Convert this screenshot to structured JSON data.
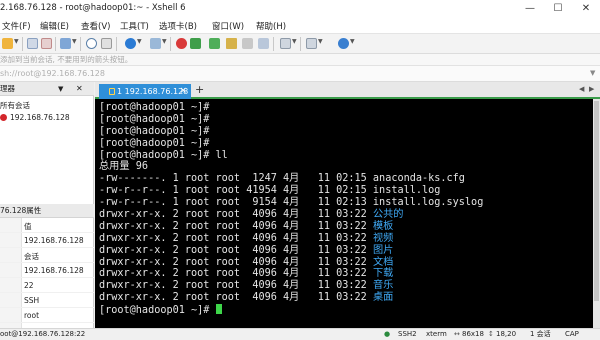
{
  "window": {
    "title": "2.168.76.128 - root@hadoop01:~ - Xshell 6",
    "minimize_icon": "minimize-icon",
    "maximize_icon": "maximize-icon",
    "close_icon": "close-icon"
  },
  "menu": {
    "items": [
      {
        "label": "文件(F)"
      },
      {
        "label": "编辑(E)"
      },
      {
        "label": "查看(V)"
      },
      {
        "label": "工具(T)"
      },
      {
        "label": "选项卡(B)"
      },
      {
        "label": "窗口(W)"
      },
      {
        "label": "帮助(H)"
      }
    ]
  },
  "hint_text": "添加到当前会话,              不要用到的箭头按钮。",
  "address": {
    "value": "sh://root@192.168.76.128",
    "dropdown_icon": "chevron-down-icon"
  },
  "session_panel": {
    "title": "理器",
    "pin_icon": "pin-icon",
    "close_icon": "close-icon",
    "root_label": "所有会话",
    "session_label": "192.168.76.128",
    "session_icon": "session-icon"
  },
  "properties_panel": {
    "title": "76.128属性",
    "header_value": "值",
    "values": [
      "192.168.76.128",
      "会话",
      "192.168.76.128",
      "22",
      "SSH",
      "root"
    ]
  },
  "tab": {
    "label": "1 192.168.76.128",
    "add_label": "+",
    "lock_icon": "lock-icon",
    "close_label": "×"
  },
  "terminal": {
    "lines": [
      {
        "text": "[root@hadoop01 ~]#"
      },
      {
        "text": "[root@hadoop01 ~]#"
      },
      {
        "text": "[root@hadoop01 ~]#"
      },
      {
        "text": "[root@hadoop01 ~]#"
      },
      {
        "text": "[root@hadoop01 ~]# ll"
      },
      {
        "text": "总用量 96"
      },
      {
        "text": "-rw-------. 1 root root  1247 4月   11 02:15 anaconda-ks.cfg"
      },
      {
        "text": "-rw-r--r--. 1 root root 41954 4月   11 02:15 install.log"
      },
      {
        "text": "-rw-r--r--. 1 root root  9154 4月   11 02:13 install.log.syslog"
      },
      {
        "prefix": "drwxr-xr-x. 2 root root  4096 4月   11 03:22 ",
        "dir": "公共的"
      },
      {
        "prefix": "drwxr-xr-x. 2 root root  4096 4月   11 03:22 ",
        "dir": "模板"
      },
      {
        "prefix": "drwxr-xr-x. 2 root root  4096 4月   11 03:22 ",
        "dir": "视频"
      },
      {
        "prefix": "drwxr-xr-x. 2 root root  4096 4月   11 03:22 ",
        "dir": "图片"
      },
      {
        "prefix": "drwxr-xr-x. 2 root root  4096 4月   11 03:22 ",
        "dir": "文档"
      },
      {
        "prefix": "drwxr-xr-x. 2 root root  4096 4月   11 03:22 ",
        "dir": "下载"
      },
      {
        "prefix": "drwxr-xr-x. 2 root root  4096 4月   11 03:22 ",
        "dir": "音乐"
      },
      {
        "prefix": "drwxr-xr-x. 2 root root  4096 4月   11 03:22 ",
        "dir": "桌面"
      }
    ],
    "prompt": "[root@hadoop01 ~]# ",
    "colors": {
      "background": "#000000",
      "text": "#e4e4e4",
      "directory": "#3fa9f5",
      "cursor": "#3ed64a"
    }
  },
  "status": {
    "connection": "oot@192.168.76.128:22",
    "protocol": "SSH2",
    "terminal_type": "xterm",
    "size": "86x18",
    "position": "18,20",
    "sessions": "1 会话",
    "caps": "CAP"
  },
  "colors": {
    "tab_active": "#2f8fd8",
    "tab_underline": "#3a9c4a",
    "session_icon": "#d3262b"
  }
}
